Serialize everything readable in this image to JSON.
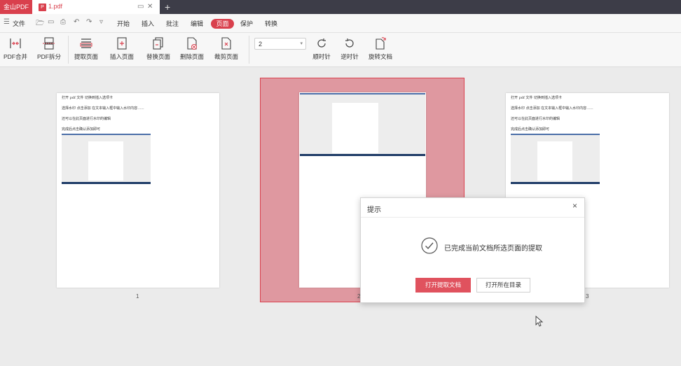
{
  "titlebar": {
    "brand": "金山PDF",
    "tab_badge": "P",
    "tab_name": "1.pdf",
    "new_tab": "+"
  },
  "menubar": {
    "file": "文件",
    "tabs": [
      "开始",
      "插入",
      "批注",
      "编辑",
      "页面",
      "保护",
      "转换"
    ],
    "active_tab": "页面"
  },
  "ribbon": {
    "buttons": {
      "merge": "PDF合并",
      "split": "PDF拆分",
      "extract": "提取页面",
      "insert": "插入页面",
      "replace": "替换页面",
      "delete": "删除页面",
      "crop": "裁剪页面",
      "cw": "顺时针",
      "ccw": "逆时针",
      "rotate_doc": "旋转文档"
    },
    "page_select_value": "2"
  },
  "pages": [
    {
      "number": "1",
      "lines": [
        "打开 pdf 文件  切换到插入选项卡",
        "选择水印   点击添加   在文本输入框中输入水印内容......",
        "还可以在此页面进行水印的编辑",
        "完成后点击确认添加即可"
      ]
    },
    {
      "number": "2"
    },
    {
      "number": "3",
      "lines": [
        "打开 pdf 文件  切换到插入选项卡",
        "选择水印   点击添加   在文本输入框中输入水印内容......",
        "还可以在此页面进行水印的编辑",
        "完成后点击确认添加即可"
      ]
    }
  ],
  "dialog": {
    "title": "提示",
    "close": "×",
    "message": "已完成当前文档所选页面的提取",
    "primary_button": "打开提取文档",
    "secondary_button": "打开所在目录"
  },
  "colors": {
    "accent": "#d9404d",
    "selection": "#df98a0",
    "titlebar": "#3d3d48"
  }
}
